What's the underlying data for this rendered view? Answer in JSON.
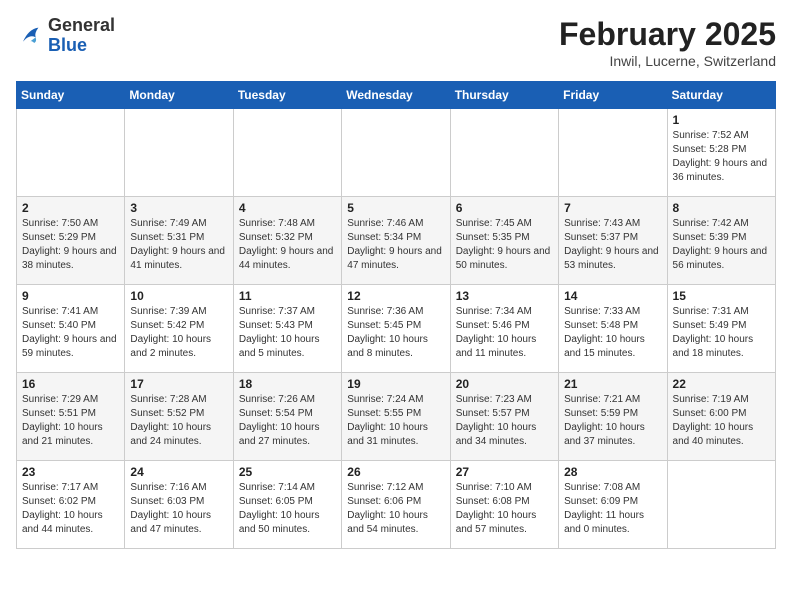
{
  "logo": {
    "general": "General",
    "blue": "Blue"
  },
  "header": {
    "month_year": "February 2025",
    "location": "Inwil, Lucerne, Switzerland"
  },
  "days_of_week": [
    "Sunday",
    "Monday",
    "Tuesday",
    "Wednesday",
    "Thursday",
    "Friday",
    "Saturday"
  ],
  "weeks": [
    [
      {
        "day": "",
        "info": ""
      },
      {
        "day": "",
        "info": ""
      },
      {
        "day": "",
        "info": ""
      },
      {
        "day": "",
        "info": ""
      },
      {
        "day": "",
        "info": ""
      },
      {
        "day": "",
        "info": ""
      },
      {
        "day": "1",
        "info": "Sunrise: 7:52 AM\nSunset: 5:28 PM\nDaylight: 9 hours and 36 minutes."
      }
    ],
    [
      {
        "day": "2",
        "info": "Sunrise: 7:50 AM\nSunset: 5:29 PM\nDaylight: 9 hours and 38 minutes."
      },
      {
        "day": "3",
        "info": "Sunrise: 7:49 AM\nSunset: 5:31 PM\nDaylight: 9 hours and 41 minutes."
      },
      {
        "day": "4",
        "info": "Sunrise: 7:48 AM\nSunset: 5:32 PM\nDaylight: 9 hours and 44 minutes."
      },
      {
        "day": "5",
        "info": "Sunrise: 7:46 AM\nSunset: 5:34 PM\nDaylight: 9 hours and 47 minutes."
      },
      {
        "day": "6",
        "info": "Sunrise: 7:45 AM\nSunset: 5:35 PM\nDaylight: 9 hours and 50 minutes."
      },
      {
        "day": "7",
        "info": "Sunrise: 7:43 AM\nSunset: 5:37 PM\nDaylight: 9 hours and 53 minutes."
      },
      {
        "day": "8",
        "info": "Sunrise: 7:42 AM\nSunset: 5:39 PM\nDaylight: 9 hours and 56 minutes."
      }
    ],
    [
      {
        "day": "9",
        "info": "Sunrise: 7:41 AM\nSunset: 5:40 PM\nDaylight: 9 hours and 59 minutes."
      },
      {
        "day": "10",
        "info": "Sunrise: 7:39 AM\nSunset: 5:42 PM\nDaylight: 10 hours and 2 minutes."
      },
      {
        "day": "11",
        "info": "Sunrise: 7:37 AM\nSunset: 5:43 PM\nDaylight: 10 hours and 5 minutes."
      },
      {
        "day": "12",
        "info": "Sunrise: 7:36 AM\nSunset: 5:45 PM\nDaylight: 10 hours and 8 minutes."
      },
      {
        "day": "13",
        "info": "Sunrise: 7:34 AM\nSunset: 5:46 PM\nDaylight: 10 hours and 11 minutes."
      },
      {
        "day": "14",
        "info": "Sunrise: 7:33 AM\nSunset: 5:48 PM\nDaylight: 10 hours and 15 minutes."
      },
      {
        "day": "15",
        "info": "Sunrise: 7:31 AM\nSunset: 5:49 PM\nDaylight: 10 hours and 18 minutes."
      }
    ],
    [
      {
        "day": "16",
        "info": "Sunrise: 7:29 AM\nSunset: 5:51 PM\nDaylight: 10 hours and 21 minutes."
      },
      {
        "day": "17",
        "info": "Sunrise: 7:28 AM\nSunset: 5:52 PM\nDaylight: 10 hours and 24 minutes."
      },
      {
        "day": "18",
        "info": "Sunrise: 7:26 AM\nSunset: 5:54 PM\nDaylight: 10 hours and 27 minutes."
      },
      {
        "day": "19",
        "info": "Sunrise: 7:24 AM\nSunset: 5:55 PM\nDaylight: 10 hours and 31 minutes."
      },
      {
        "day": "20",
        "info": "Sunrise: 7:23 AM\nSunset: 5:57 PM\nDaylight: 10 hours and 34 minutes."
      },
      {
        "day": "21",
        "info": "Sunrise: 7:21 AM\nSunset: 5:59 PM\nDaylight: 10 hours and 37 minutes."
      },
      {
        "day": "22",
        "info": "Sunrise: 7:19 AM\nSunset: 6:00 PM\nDaylight: 10 hours and 40 minutes."
      }
    ],
    [
      {
        "day": "23",
        "info": "Sunrise: 7:17 AM\nSunset: 6:02 PM\nDaylight: 10 hours and 44 minutes."
      },
      {
        "day": "24",
        "info": "Sunrise: 7:16 AM\nSunset: 6:03 PM\nDaylight: 10 hours and 47 minutes."
      },
      {
        "day": "25",
        "info": "Sunrise: 7:14 AM\nSunset: 6:05 PM\nDaylight: 10 hours and 50 minutes."
      },
      {
        "day": "26",
        "info": "Sunrise: 7:12 AM\nSunset: 6:06 PM\nDaylight: 10 hours and 54 minutes."
      },
      {
        "day": "27",
        "info": "Sunrise: 7:10 AM\nSunset: 6:08 PM\nDaylight: 10 hours and 57 minutes."
      },
      {
        "day": "28",
        "info": "Sunrise: 7:08 AM\nSunset: 6:09 PM\nDaylight: 11 hours and 0 minutes."
      },
      {
        "day": "",
        "info": ""
      }
    ]
  ]
}
